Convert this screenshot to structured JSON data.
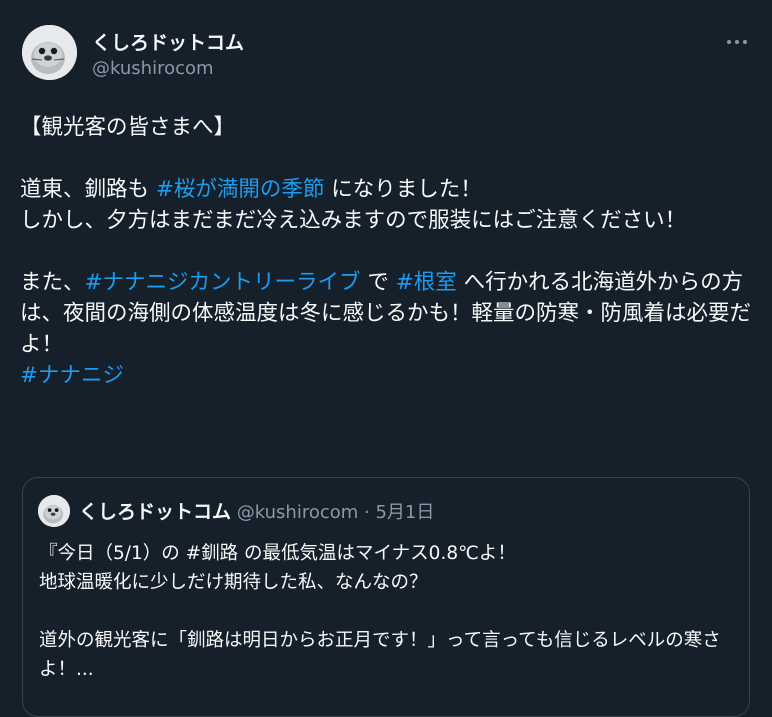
{
  "author": {
    "name": "くしろドットコム",
    "handle": "@kushirocom"
  },
  "tweet": {
    "line1": "【観光客の皆さまへ】",
    "line2_pre": "道東、釧路も ",
    "line2_tag": "#桜が満開の季節",
    "line2_post": " になりました！",
    "line3": "しかし、夕方はまだまだ冷え込みますので服装にはご注意ください！",
    "line4_pre": "また、",
    "line4_tag1": "#ナナニジカントリーライブ",
    "line4_mid": " で ",
    "line4_tag2": "#根室",
    "line4_post": " へ行かれる北海道外からの方は、夜間の海側の体感温度は冬に感じるかも！軽量の防寒・防風着は必要だよ！",
    "line5_tag": "#ナナニジ"
  },
  "quote": {
    "name": "くしろドットコム",
    "handle": "@kushirocom",
    "separator": "·",
    "date": "5月1日",
    "line1": "『今日（5/1）の #釧路 の最低気温はマイナス0.8℃よ！",
    "line2": "地球温暖化に少しだけ期待した私、なんなの？",
    "line3": "道外の観光客に「釧路は明日からお正月です！」って言っても信じるレベルの寒さよ！..."
  },
  "colors": {
    "background": "#15202b",
    "text": "#f7f9f9",
    "secondary": "#8b98a5",
    "link": "#1d9bf0",
    "border": "#38444d"
  },
  "icons": {
    "more": "more-horizontal-icon",
    "avatar": "seal-mascot-avatar"
  }
}
